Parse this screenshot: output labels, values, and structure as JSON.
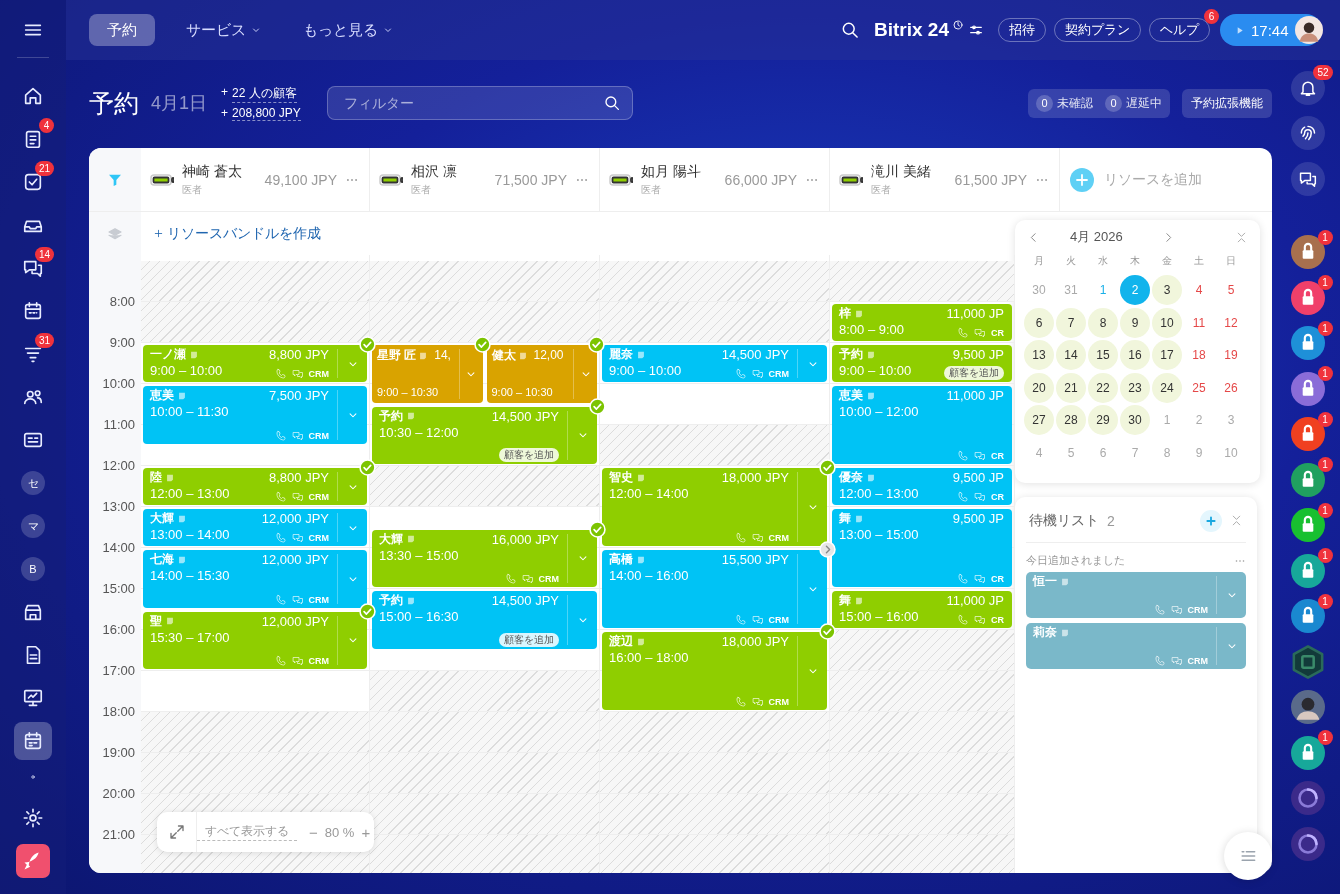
{
  "sidebar": {
    "items": [
      {
        "kind": "home",
        "selected": false
      },
      {
        "kind": "tasks",
        "badge": "4",
        "selected": false
      },
      {
        "kind": "checklist",
        "badge": "21",
        "selected": false
      },
      {
        "kind": "tray",
        "selected": false
      },
      {
        "kind": "chat",
        "badge": "14",
        "selected": false
      },
      {
        "kind": "calendar",
        "selected": false
      },
      {
        "kind": "funnel",
        "badge": "31",
        "selected": false
      },
      {
        "kind": "contacts",
        "selected": false
      },
      {
        "kind": "card",
        "selected": false
      },
      {
        "kind": "letter",
        "label": "セ",
        "selected": false
      },
      {
        "kind": "letter",
        "label": "マ",
        "selected": false
      },
      {
        "kind": "letter",
        "label": "B",
        "selected": false
      },
      {
        "kind": "store",
        "selected": false
      },
      {
        "kind": "document",
        "selected": false
      },
      {
        "kind": "board",
        "selected": false
      },
      {
        "kind": "booking",
        "selected": true
      },
      {
        "kind": "dot",
        "selected": false
      },
      {
        "kind": "settings",
        "selected": false
      },
      {
        "kind": "rocket",
        "selected": false
      }
    ]
  },
  "topbar": {
    "tabs": [
      {
        "label": "予約",
        "selected": true,
        "dropdown": false
      },
      {
        "label": "サービス",
        "selected": false,
        "dropdown": true
      },
      {
        "label": "もっと見る",
        "selected": false,
        "dropdown": true
      }
    ],
    "brand": "Bitrix 24",
    "buttons": [
      {
        "label": "招待"
      },
      {
        "label": "契約プラン"
      },
      {
        "label": "ヘルプ",
        "badge": "6"
      }
    ],
    "timer": "17:44"
  },
  "header": {
    "title": "予約",
    "date": "4月1日",
    "stats": [
      {
        "prefix": "+",
        "text": "22 人の顧客"
      },
      {
        "prefix": "+",
        "text": "208,800 JPY"
      }
    ],
    "filter": {
      "placeholder": "フィルター"
    },
    "counters": [
      {
        "count": "0",
        "label": "未確認"
      },
      {
        "count": "0",
        "label": "遅延中"
      }
    ],
    "extensions_button": "予約拡張機能"
  },
  "resources": [
    {
      "name": "神崎 蒼太",
      "role": "医者",
      "total": "49,100 JPY",
      "available": [
        false,
        false,
        true,
        true,
        true,
        true,
        true,
        true,
        true,
        true,
        true,
        false,
        false,
        false,
        false
      ],
      "events": [
        {
          "kind": "single",
          "name": "一ノ瀬",
          "price": "8,800 JPY",
          "time": "9:00 – 10:00",
          "color": "#8fce00",
          "confirmed": true,
          "crm": "CRM",
          "menu_button": true
        },
        {
          "kind": "single",
          "name": "恵美",
          "price": "7,500 JPY",
          "time": "10:00 – 11:30",
          "color": "#00c3f5",
          "confirmed": false,
          "crm": "CRM",
          "menu_button": true
        },
        {
          "kind": "single",
          "name": "陸",
          "price": "8,800 JPY",
          "time": "12:00 – 13:00",
          "color": "#8fce00",
          "confirmed": true,
          "crm": "CRM",
          "menu_button": true
        },
        {
          "kind": "single",
          "name": "大輝",
          "price": "12,000 JPY",
          "time": "13:00 – 14:00",
          "color": "#00c3f5",
          "confirmed": false,
          "crm": "CRM",
          "menu_button": true
        },
        {
          "kind": "single",
          "name": "七海",
          "price": "12,000 JPY",
          "time": "14:00 – 15:30",
          "color": "#00c3f5",
          "confirmed": false,
          "crm": "CRM",
          "menu_button": true
        },
        {
          "kind": "single",
          "name": "聖",
          "price": "12,000 JPY",
          "time": "15:30 – 17:00",
          "color": "#8fce00",
          "confirmed": true,
          "crm": "CRM",
          "menu_button": true
        }
      ]
    },
    {
      "name": "相沢 凛",
      "role": "医者",
      "total": "71,500 JPY",
      "available": [
        false,
        false,
        true,
        true,
        true,
        false,
        true,
        true,
        true,
        true,
        false,
        false,
        false,
        false,
        false
      ],
      "events": [
        {
          "kind": "parallel",
          "events": [
            {
              "name": "星野 匠",
              "price": "14,",
              "time": "9:00 – 10:30",
              "color": "#d9a300",
              "confirmed": true,
              "menu_button": true
            },
            {
              "name": "健太",
              "price": "12,00",
              "time": "9:00 – 10:30",
              "color": "#d9a300",
              "confirmed": true,
              "menu_button": true
            }
          ]
        },
        {
          "kind": "single",
          "name": "予約",
          "price": "14,500 JPY",
          "time": "10:30 – 12:00",
          "color": "#8fce00",
          "confirmed": true,
          "add_client": "顧客を追加",
          "menu_button": true
        },
        {
          "kind": "single",
          "name": "大輝",
          "price": "16,000 JPY",
          "time": "13:30 – 15:00",
          "color": "#8fce00",
          "confirmed": true,
          "crm": "CRM",
          "menu_button": true
        },
        {
          "kind": "single",
          "name": "予約",
          "price": "14,500 JPY",
          "time": "15:00 – 16:30",
          "color": "#00c3f5",
          "confirmed": false,
          "add_client": "顧客を追加",
          "menu_button": true
        }
      ]
    },
    {
      "name": "如月 陽斗",
      "role": "医者",
      "total": "66,000 JPY",
      "available": [
        false,
        false,
        true,
        true,
        false,
        true,
        true,
        true,
        true,
        true,
        true,
        false,
        false,
        false,
        false
      ],
      "events": [
        {
          "kind": "single",
          "name": "麗奈",
          "price": "14,500 JPY",
          "time": "9:00 – 10:00",
          "color": "#00c3f5",
          "confirmed": false,
          "crm": "CRM",
          "menu_button": true
        },
        {
          "kind": "single",
          "name": "智史",
          "price": "18,000 JPY",
          "time": "12:00 – 14:00",
          "color": "#8fce00",
          "confirmed": true,
          "crm": "CRM",
          "menu_button": true
        },
        {
          "kind": "single",
          "name": "高橋",
          "price": "15,500 JPY",
          "time": "14:00 – 16:00",
          "color": "#00c3f5",
          "confirmed": false,
          "pending": true,
          "crm": "CRM",
          "menu_button": true
        },
        {
          "kind": "single",
          "name": "渡辺",
          "price": "18,000 JPY",
          "time": "16:00 – 18:00",
          "color": "#8fce00",
          "confirmed": true,
          "crm": "CRM",
          "menu_button": true
        }
      ]
    },
    {
      "name": "滝川 美緒",
      "role": "医者",
      "total": "61,500 JPY",
      "available": [
        false,
        true,
        true,
        true,
        true,
        true,
        true,
        true,
        true,
        false,
        false,
        false,
        false,
        false,
        false
      ],
      "events": [
        {
          "kind": "single",
          "name": "梓",
          "price": "11,000 JP",
          "time": "8:00 – 9:00",
          "color": "#8fce00",
          "confirmed": false,
          "crm": "CR",
          "menu_button": false
        },
        {
          "kind": "single",
          "name": "予約",
          "price": "9,500 JP",
          "time": "9:00 – 10:00",
          "color": "#8fce00",
          "confirmed": false,
          "add_client": "顧客を追加",
          "menu_button": false
        },
        {
          "kind": "single",
          "name": "恵美",
          "price": "11,000 JP",
          "time": "10:00 – 12:00",
          "color": "#00c3f5",
          "confirmed": false,
          "crm": "CR",
          "menu_button": false
        },
        {
          "kind": "single",
          "name": "優奈",
          "price": "9,500 JP",
          "time": "12:00 – 13:00",
          "color": "#00c3f5",
          "confirmed": false,
          "crm": "CR",
          "menu_button": false
        },
        {
          "kind": "single",
          "name": "舞",
          "price": "9,500 JP",
          "time": "13:00 – 15:00",
          "color": "#00c3f5",
          "confirmed": false,
          "crm": "CR",
          "menu_button": false
        },
        {
          "kind": "single",
          "name": "舞",
          "price": "11,000 JP",
          "time": "15:00 – 16:00",
          "color": "#8fce00",
          "confirmed": false,
          "crm": "CR",
          "menu_button": false
        }
      ]
    }
  ],
  "add_resource": "リソースを追加",
  "bundle_link": "リソースバンドルを作成",
  "times": [
    "8:00",
    "9:00",
    "10:00",
    "11:00",
    "12:00",
    "13:00",
    "14:00",
    "15:00",
    "16:00",
    "17:00",
    "18:00",
    "19:00",
    "20:00",
    "21:00"
  ],
  "calendar": {
    "month": "4月 2026",
    "weekdays": [
      "月",
      "火",
      "水",
      "木",
      "金",
      "土",
      "日"
    ],
    "weeks": [
      [
        {
          "label": "30",
          "kind": "other",
          "selected": false
        },
        {
          "label": "31",
          "kind": "other",
          "selected": false
        },
        {
          "label": "1",
          "kind": "today",
          "selected": false
        },
        {
          "label": "2",
          "kind": "busy",
          "selected": true
        },
        {
          "label": "3",
          "kind": "busy",
          "selected": false
        },
        {
          "label": "4",
          "kind": "weekend",
          "selected": false
        },
        {
          "label": "5",
          "kind": "weekend",
          "selected": false
        }
      ],
      [
        {
          "label": "6",
          "kind": "busy",
          "selected": false
        },
        {
          "label": "7",
          "kind": "busy",
          "selected": false
        },
        {
          "label": "8",
          "kind": "busy",
          "selected": false
        },
        {
          "label": "9",
          "kind": "busy",
          "selected": false
        },
        {
          "label": "10",
          "kind": "busy",
          "selected": false
        },
        {
          "label": "11",
          "kind": "weekend",
          "selected": false
        },
        {
          "label": "12",
          "kind": "weekend",
          "selected": false
        }
      ],
      [
        {
          "label": "13",
          "kind": "busy",
          "selected": false
        },
        {
          "label": "14",
          "kind": "busy",
          "selected": false
        },
        {
          "label": "15",
          "kind": "busy",
          "selected": false
        },
        {
          "label": "16",
          "kind": "busy",
          "selected": false
        },
        {
          "label": "17",
          "kind": "busy",
          "selected": false
        },
        {
          "label": "18",
          "kind": "weekend",
          "selected": false
        },
        {
          "label": "19",
          "kind": "weekend",
          "selected": false
        }
      ],
      [
        {
          "label": "20",
          "kind": "busy",
          "selected": false
        },
        {
          "label": "21",
          "kind": "busy",
          "selected": false
        },
        {
          "label": "22",
          "kind": "busy",
          "selected": false
        },
        {
          "label": "23",
          "kind": "busy",
          "selected": false
        },
        {
          "label": "24",
          "kind": "busy",
          "selected": false
        },
        {
          "label": "25",
          "kind": "weekend",
          "selected": false
        },
        {
          "label": "26",
          "kind": "weekend",
          "selected": false
        }
      ],
      [
        {
          "label": "27",
          "kind": "busy",
          "selected": false
        },
        {
          "label": "28",
          "kind": "busy",
          "selected": false
        },
        {
          "label": "29",
          "kind": "busy",
          "selected": false
        },
        {
          "label": "30",
          "kind": "busy",
          "selected": false
        },
        {
          "label": "1",
          "kind": "other",
          "selected": false
        },
        {
          "label": "2",
          "kind": "other",
          "selected": false
        },
        {
          "label": "3",
          "kind": "other",
          "selected": false
        }
      ],
      [
        {
          "label": "4",
          "kind": "other",
          "selected": false
        },
        {
          "label": "5",
          "kind": "other",
          "selected": false
        },
        {
          "label": "6",
          "kind": "other",
          "selected": false
        },
        {
          "label": "7",
          "kind": "other",
          "selected": false
        },
        {
          "label": "8",
          "kind": "other",
          "selected": false
        },
        {
          "label": "9",
          "kind": "other",
          "selected": false
        },
        {
          "label": "10",
          "kind": "other",
          "selected": false
        }
      ]
    ]
  },
  "waitlist": {
    "title": "待機リスト",
    "count": "2",
    "section": "今日追加されました",
    "items": [
      {
        "name": "恒一",
        "crm": "CRM"
      },
      {
        "name": "莉奈",
        "crm": "CRM"
      }
    ]
  },
  "zoom_control": {
    "show_all": "すべて表示する",
    "minus": "−",
    "value": "80 %",
    "plus": "+"
  },
  "right_rail": [
    {
      "kind": "bell",
      "badge": "52"
    },
    {
      "kind": "fingerprint"
    },
    {
      "kind": "chat"
    },
    {
      "kind": "lock",
      "color": "#a8704e",
      "badge": "1"
    },
    {
      "kind": "lock",
      "color": "#f0406a",
      "badge": "1"
    },
    {
      "kind": "lock",
      "color": "#1e90d8",
      "badge": "1"
    },
    {
      "kind": "lock",
      "color": "#8a6cd8",
      "badge": "1"
    },
    {
      "kind": "lock",
      "color": "#f04020",
      "badge": "1"
    },
    {
      "kind": "lock",
      "color": "#20a060",
      "badge": "1"
    },
    {
      "kind": "lock",
      "color": "#18c030",
      "badge": "1"
    },
    {
      "kind": "lock",
      "color": "#17a89a",
      "badge": "1"
    },
    {
      "kind": "lock",
      "color": "#1a88d0",
      "badge": "1"
    },
    {
      "kind": "hexagon"
    },
    {
      "kind": "person"
    },
    {
      "kind": "lock",
      "color": "#17a89a",
      "badge": "1"
    },
    {
      "kind": "swirl"
    },
    {
      "kind": "swirl"
    }
  ]
}
